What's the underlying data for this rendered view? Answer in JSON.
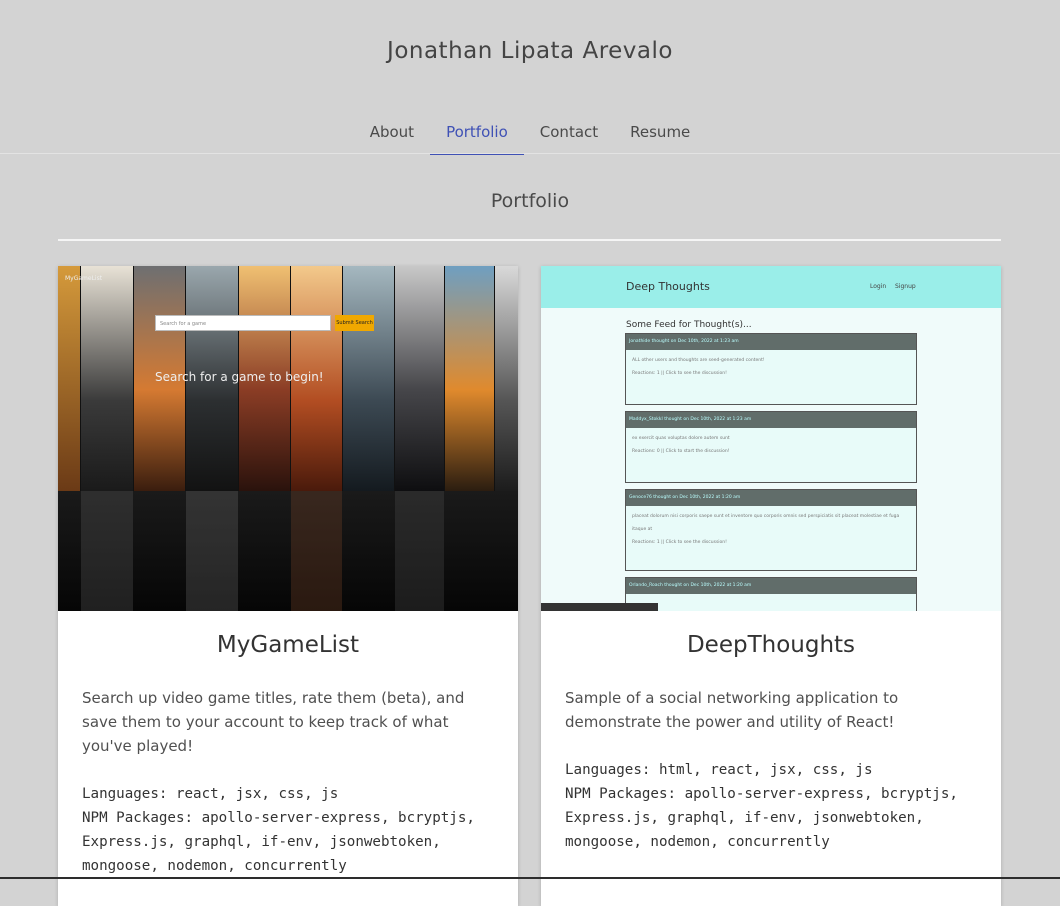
{
  "header": {
    "site_title": "Jonathan Lipata Arevalo"
  },
  "nav": {
    "items": [
      {
        "label": "About"
      },
      {
        "label": "Portfolio",
        "active": true
      },
      {
        "label": "Contact"
      },
      {
        "label": "Resume"
      }
    ]
  },
  "portfolio": {
    "section_title": "Portfolio",
    "projects": [
      {
        "title": "MyGameList",
        "description": "Search up video game titles, rate them (beta), and save them to your account to keep track of what you've played!",
        "languages": "Languages: react, jsx, css, js",
        "packages": "NPM Packages: apollo-server-express, bcryptjs, Express.js, graphql, if-env, jsonwebtoken, mongoose, nodemon, concurrently",
        "screenshot": {
          "logo": "MyGameList",
          "search_placeholder": "Search for a game",
          "button": "Submit Search",
          "message": "Search for a game to begin!"
        }
      },
      {
        "title": "DeepThoughts",
        "description": "Sample of a social networking application to demonstrate the power and utility of React!",
        "languages": "Languages: html, react, jsx, css, js",
        "packages": "NPM Packages: apollo-server-express, bcryptjs, Express.js, graphql, if-env, jsonwebtoken, mongoose, nodemon, concurrently",
        "screenshot": {
          "logo": "Deep Thoughts",
          "nav_login": "Login",
          "nav_signup": "Signup",
          "feed_title": "Some Feed for Thought(s)...",
          "posts": [
            {
              "header": "Jonathide thought on Dec 10th, 2022 at 1:23 am",
              "body1": "ALL other users and thoughts are seed-generated content!",
              "body2": "Reactions: 1 || Click to see the discussion!"
            },
            {
              "header": "Maddyx_Stokkl thought on Dec 10th, 2022 at 1:23 am",
              "body1": "ex exercit quas voluptas dolore autem sunt",
              "body2": "Reactions: 0 || Click to start the discussion!"
            },
            {
              "header": "Genoce76 thought on Dec 10th, 2022 at 1:20 am",
              "body1": "placeat dolorum nisi corporis saepe sunt et inventore quo corporis omnis sed perspiciatis sit placeat molestiae et fuga itaque at",
              "body2": "Reactions: 1 || Click to see the discussion!"
            },
            {
              "header": "Orlando_Roach thought on Dec 10th, 2022 at 1:20 am",
              "body1": "",
              "body2": ""
            }
          ]
        }
      }
    ]
  },
  "colors": {
    "background": "#d3d3d3",
    "accent": "#3f51b5",
    "card": "#ffffff"
  }
}
